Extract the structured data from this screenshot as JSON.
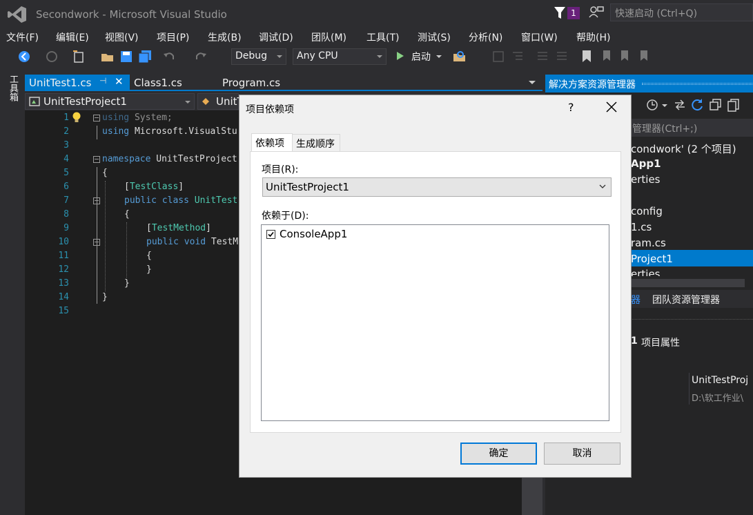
{
  "window": {
    "title": "Secondwork - Microsoft Visual Studio",
    "notification_count": "1",
    "quick_launch_placeholder": "快速启动 (Ctrl+Q)"
  },
  "menu": [
    "文件(F)",
    "编辑(E)",
    "视图(V)",
    "项目(P)",
    "生成(B)",
    "调试(D)",
    "团队(M)",
    "工具(T)",
    "测试(S)",
    "分析(N)",
    "窗口(W)",
    "帮助(H)"
  ],
  "toolbar": {
    "configuration": "Debug",
    "platform": "Any CPU",
    "start_label": "启动"
  },
  "toolbox_label": "工具箱",
  "editor_tabs": [
    "UnitTest1.cs",
    "Class1.cs",
    "Program.cs"
  ],
  "navbar": {
    "project": "UnitTestProject1",
    "member_partial": "UnitT"
  },
  "code": {
    "line_numbers": [
      "1",
      "2",
      "3",
      "4",
      "5",
      "6",
      "7",
      "8",
      "9",
      "10",
      "11",
      "12",
      "13",
      "14",
      "15"
    ],
    "l1_kw": "using",
    "l1_rest": " System;",
    "l2_kw": "using",
    "l2_rest": " Microsoft.VisualStu",
    "l4_kw": "namespace",
    "l4_rest": " UnitTestProject",
    "l5": "{",
    "l6_open": "[",
    "l6_type": "TestClass",
    "l6_close": "]",
    "l7_kw": "public class",
    "l7_rest": " UnitTest",
    "l8": "{",
    "l9_open": "[",
    "l9_type": "TestMethod",
    "l9_close": "]",
    "l10_kw": "public void",
    "l10_rest": " TestM",
    "l11": "{",
    "l12": "}",
    "l13": "}",
    "l14": "}"
  },
  "solution_explorer": {
    "header": "解决方案资源管理器",
    "search_placeholder": "管理器(Ctrl+;)",
    "solution": "condwork' (2 个项目)",
    "project1": "App1",
    "properties1": "erties",
    "config": "config",
    "class1": "1.cs",
    "program": "ram.cs",
    "project2": "Project1",
    "properties2": "erties",
    "bottom_tab1": "器",
    "bottom_tab2": "团队资源管理器",
    "props_title_num": "1",
    "props_title": "项目属性",
    "prop_value1": "UnitTestProj",
    "prop_value2": "D:\\软工作业\\"
  },
  "dialog": {
    "title": "项目依赖项",
    "help": "?",
    "tab_dependencies": "依赖项",
    "tab_build_order": "生成顺序",
    "project_label": "项目(R):",
    "project_value": "UnitTestProject1",
    "depends_on_label": "依赖于(D):",
    "dependencies": [
      {
        "label": "ConsoleApp1",
        "checked": true
      }
    ],
    "ok": "确定",
    "cancel": "取消"
  }
}
